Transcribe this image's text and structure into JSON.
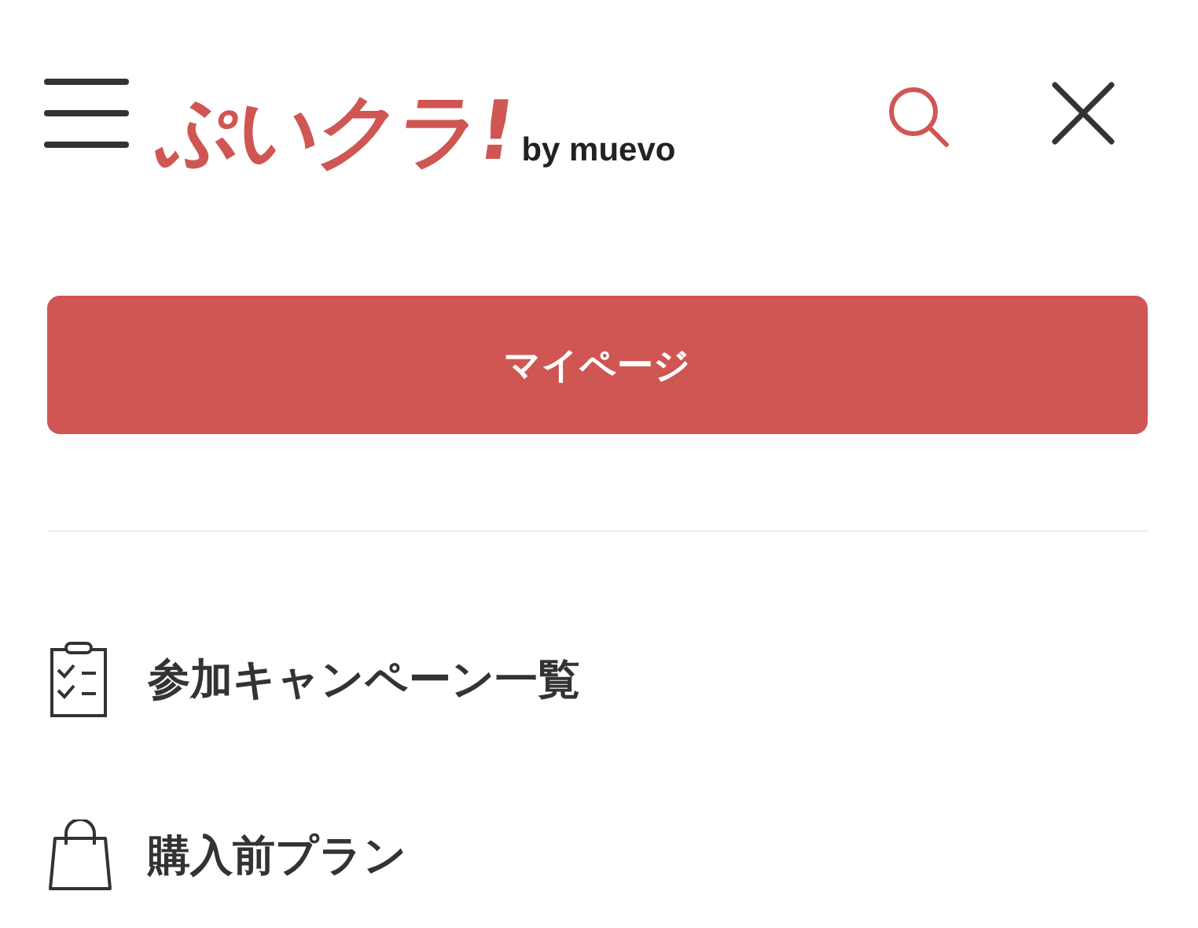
{
  "header": {
    "logo": "ぷいクラ!",
    "logo_suffix": "by muevo"
  },
  "primary_button": "マイページ",
  "menu_items": [
    {
      "kind": "checklist",
      "label": "参加キャンペーン一覧"
    },
    {
      "kind": "bag",
      "label": "購入前プラン"
    }
  ]
}
